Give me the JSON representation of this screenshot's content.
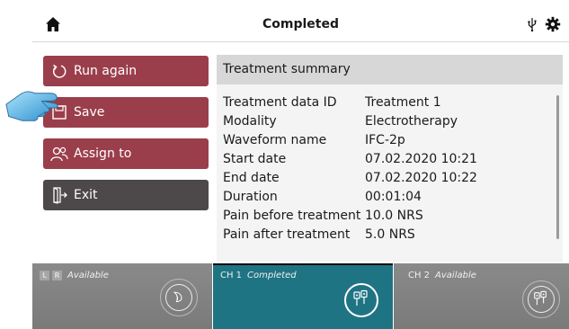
{
  "header": {
    "title": "Completed",
    "icons": [
      "home-icon",
      "usb-icon",
      "gear-icon"
    ]
  },
  "actions": {
    "run_again": "Run again",
    "save": "Save",
    "assign_to": "Assign to",
    "exit": "Exit"
  },
  "summary": {
    "title": "Treatment summary",
    "rows": [
      {
        "label": "Treatment data ID",
        "value": "Treatment 1"
      },
      {
        "label": "Modality",
        "value": "Electrotherapy"
      },
      {
        "label": "Waveform name",
        "value": "IFC-2p"
      },
      {
        "label": "Start date",
        "value": "07.02.2020 10:21"
      },
      {
        "label": "End date",
        "value": "07.02.2020 10:22"
      },
      {
        "label": "Duration",
        "value": "00:01:04"
      },
      {
        "label": "Pain before treatment",
        "value": "10.0 NRS"
      },
      {
        "label": "Pain after treatment",
        "value": "5.0 NRS"
      }
    ]
  },
  "channels": {
    "left": {
      "l": "L",
      "r": "R",
      "status": "Available"
    },
    "ch1": {
      "name": "CH 1",
      "status": "Completed"
    },
    "ch2": {
      "name": "CH 2",
      "status": "Available"
    }
  },
  "colors": {
    "action_red": "#9b3e4c",
    "action_dark": "#4d4849",
    "channel_active": "#1f7483",
    "channel_idle": "#848484"
  }
}
